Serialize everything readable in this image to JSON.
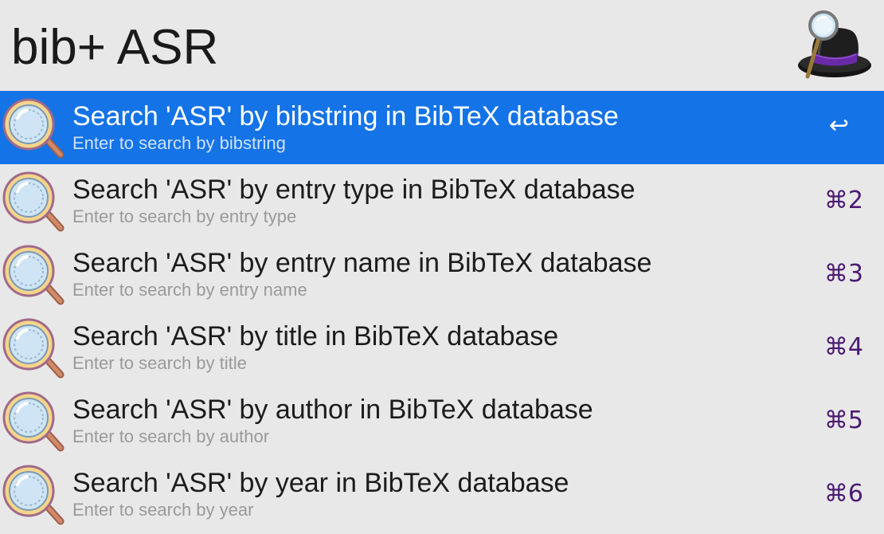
{
  "query": {
    "value": "bib+ ASR"
  },
  "app": {
    "logo_icon": "alfred-hat-logo"
  },
  "results": [
    {
      "title": "Search 'ASR' by bibstring in BibTeX database",
      "subtitle": "Enter to search by bibstring",
      "shortcut": "↩",
      "selected": true,
      "icon": "magnifier-icon"
    },
    {
      "title": "Search 'ASR' by entry type in BibTeX database",
      "subtitle": "Enter to search by entry type",
      "shortcut": "⌘2",
      "selected": false,
      "icon": "magnifier-icon"
    },
    {
      "title": "Search 'ASR' by entry name in BibTeX database",
      "subtitle": "Enter to search by entry name",
      "shortcut": "⌘3",
      "selected": false,
      "icon": "magnifier-icon"
    },
    {
      "title": "Search 'ASR' by title in BibTeX database",
      "subtitle": "Enter to search by title",
      "shortcut": "⌘4",
      "selected": false,
      "icon": "magnifier-icon"
    },
    {
      "title": "Search 'ASR' by author in BibTeX database",
      "subtitle": "Enter to search by author",
      "shortcut": "⌘5",
      "selected": false,
      "icon": "magnifier-icon"
    },
    {
      "title": "Search 'ASR' by year in BibTeX database",
      "subtitle": "Enter to search by year",
      "shortcut": "⌘6",
      "selected": false,
      "icon": "magnifier-icon"
    }
  ],
  "colors": {
    "background": "#e8e8e8",
    "selection": "#1473e6",
    "shortcut": "#4b1a72",
    "subtitle": "#9a9a9a"
  }
}
